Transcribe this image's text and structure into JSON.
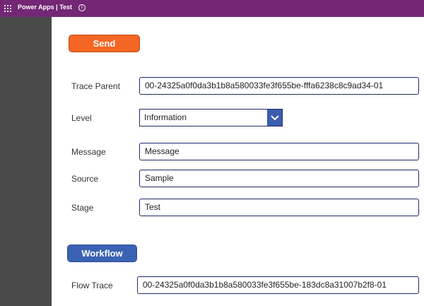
{
  "header": {
    "title": "Power Apps  |  Test",
    "info_icon": "info-icon",
    "waffle_icon": "waffle-icon"
  },
  "colors": {
    "header": "#742774",
    "sidebar": "#4a4a4a",
    "send_button": "#f56624",
    "workflow_button": "#3a62b3",
    "field_border": "#1f2a6e"
  },
  "buttons": {
    "send": "Send",
    "workflow": "Workflow"
  },
  "form": {
    "trace_parent_label": "Trace Parent",
    "trace_parent_value": "00-24325a0f0da3b1b8a580033fe3f655be-fffa6238c8c9ad34-01",
    "level_label": "Level",
    "level_value": "Information",
    "message_label": "Message",
    "message_value": "Message",
    "source_label": "Source",
    "source_value": "Sample",
    "stage_label": "Stage",
    "stage_value": "Test",
    "flow_trace_label": "Flow Trace",
    "flow_trace_value": "00-24325a0f0da3b1b8a580033fe3f655be-183dc8a31007b2f8-01"
  }
}
